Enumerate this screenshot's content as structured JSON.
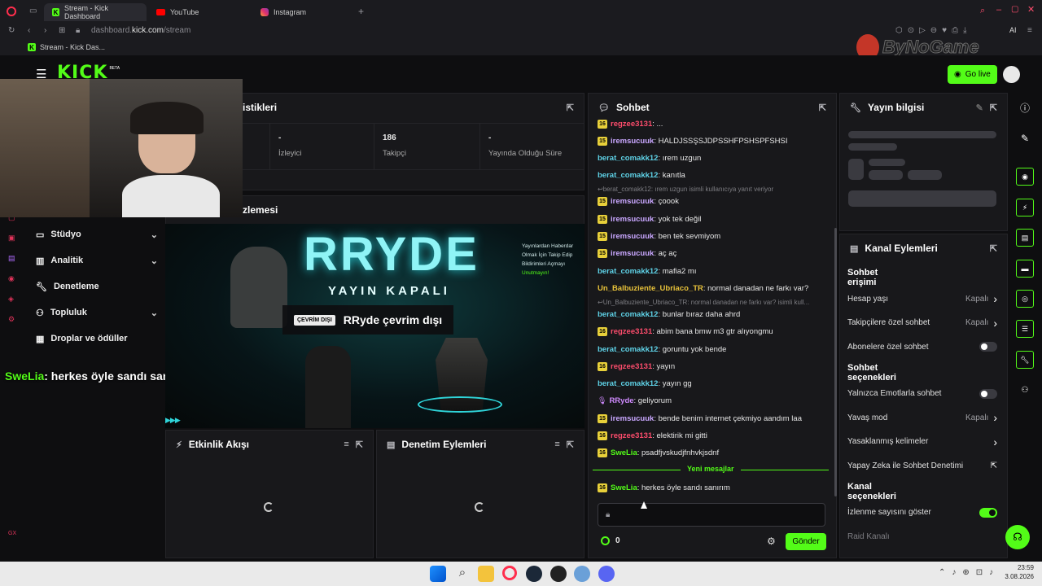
{
  "browser": {
    "tabs": [
      {
        "label": "Stream - Kick Dashboard",
        "active": true
      },
      {
        "label": "YouTube"
      },
      {
        "label": "Instagram"
      }
    ],
    "address_host": "dashboard.",
    "address_domain": "kick.com",
    "address_path": "/stream",
    "bookmark": "Stream - Kick Das..."
  },
  "watermark": "ByNoGame",
  "kick": {
    "logo": "KICK",
    "logo_beta": "BETA",
    "go_live": "Go live"
  },
  "stats": {
    "title": "istikleri",
    "cols": [
      {
        "value": "-",
        "label": "İzleyici"
      },
      {
        "value": "186",
        "label": "Takipçi"
      },
      {
        "value": "-",
        "label": "Yayında Olduğu Süre"
      }
    ]
  },
  "preview": {
    "title": "zlemesi",
    "banner_title": "RRYDE",
    "banner_sub": "YAYIN KAPALI",
    "banner_note": [
      "Yayınlardan Haberdar",
      "Olmak İçin Takip Edip",
      "Bildirimleri Açmayı"
    ],
    "banner_note_accent": "Unutmayın!",
    "offline_badge": "ÇEVRİM DIŞI",
    "offline_text": "RRyde çevrim dışı"
  },
  "sidebar": {
    "items": [
      {
        "label": "Stüdyo",
        "chevron": true
      },
      {
        "label": "Analitik",
        "chevron": true
      },
      {
        "label": "Denetleme",
        "chevron": false
      },
      {
        "label": "Topluluk",
        "chevron": true
      },
      {
        "label": "Droplar ve ödüller",
        "chevron": false
      }
    ],
    "caption_user": "SweLia",
    "caption_text": ": herkes öyle sandı sanırım",
    "footer_tag": "GX"
  },
  "activity": {
    "title": "Etkinlik Akışı"
  },
  "moderation": {
    "title": "Denetim Eylemleri"
  },
  "chat": {
    "title": "Sohbet",
    "messages": [
      {
        "badge": "16",
        "user": "regzee3131",
        "color": "#ff4d6d",
        "text": ": ..."
      },
      {
        "badge": "15",
        "user": "iremsucuuk",
        "color": "#c9a7ff",
        "text": ": HALDJSSŞSJDPSSHFPSHSPFSHSI"
      },
      {
        "badge": "",
        "user": "berat_comakk12",
        "color": "#5fd3e8",
        "text": ": ırem uzgun"
      },
      {
        "badge": "",
        "user": "berat_comakk12",
        "color": "#5fd3e8",
        "text": ": kanıtla"
      },
      {
        "reply": "berat_comakk12: ırem uzgun isimli kullanıcıya yanıt veriyor"
      },
      {
        "badge": "15",
        "user": "iremsucuuk",
        "color": "#c9a7ff",
        "text": ": çoook"
      },
      {
        "badge": "15",
        "user": "iremsucuuk",
        "color": "#c9a7ff",
        "text": ": yok tek değil"
      },
      {
        "badge": "15",
        "user": "iremsucuuk",
        "color": "#c9a7ff",
        "text": ": ben tek sevmiyom"
      },
      {
        "badge": "15",
        "user": "iremsucuuk",
        "color": "#c9a7ff",
        "text": ": aç aç"
      },
      {
        "badge": "",
        "user": "berat_comakk12",
        "color": "#5fd3e8",
        "text": ": mafia2 mı"
      },
      {
        "badge": "",
        "user": "Un_Balbuziente_Ubriaco_TR",
        "color": "#e8c23a",
        "text": ": normal danadan ne farkı var?"
      },
      {
        "reply": "Un_Balbuziente_Ubriaco_TR: normal danadan ne farkı var? isimli kull..."
      },
      {
        "badge": "",
        "user": "berat_comakk12",
        "color": "#5fd3e8",
        "text": ": bunlar bıraz daha ahrd"
      },
      {
        "badge": "16",
        "user": "regzee3131",
        "color": "#ff4d6d",
        "text": ": abim bana bmw m3 gtr alıyongmu"
      },
      {
        "badge": "",
        "user": "berat_comakk12",
        "color": "#5fd3e8",
        "text": ": goruntu yok bende"
      },
      {
        "badge": "16",
        "user": "regzee3131",
        "color": "#ff4d6d",
        "text": ": yayın"
      },
      {
        "badge": "",
        "user": "berat_comakk12",
        "color": "#5fd3e8",
        "text": ": yayın gg"
      },
      {
        "badge": "mic",
        "user": "RRyde",
        "color": "#d08bff",
        "text": ": geliyorum"
      },
      {
        "badge": "15",
        "user": "iremsucuuk",
        "color": "#c9a7ff",
        "text": ": bende benim internet çekmiyo aandım laa"
      },
      {
        "badge": "16",
        "user": "regzee3131",
        "color": "#ff4d6d",
        "text": ": elektirik mi gitti"
      },
      {
        "badge": "16",
        "user": "SweLia",
        "color": "#53fc18",
        "text": ": psadfjvskudjfnhvkjsdnf"
      }
    ],
    "new_messages": "Yeni mesajlar",
    "last_message": {
      "badge": "16",
      "user": "SweLia",
      "color": "#53fc18",
      "text": ": herkes öyle sandı sanırım"
    },
    "input_placeholder": "",
    "points": "0",
    "send": "Gönder"
  },
  "stream_info": {
    "title": "Yayın bilgisi"
  },
  "channel_actions": {
    "title": "Kanal Eylemleri",
    "sections": [
      {
        "heading": "Sohbet erişimi",
        "rows": [
          {
            "label": "Hesap yaşı",
            "value": "Kapalı",
            "kind": "arrow"
          },
          {
            "label": "Takipçilere özel sohbet",
            "value": "Kapalı",
            "kind": "arrow"
          },
          {
            "label": "Abonelere özel sohbet",
            "kind": "toggle",
            "on": false
          }
        ]
      },
      {
        "heading": "Sohbet seçenekleri",
        "rows": [
          {
            "label": "Yalnızca Emotlarla sohbet",
            "kind": "toggle",
            "on": false
          },
          {
            "label": "Yavaş mod",
            "value": "Kapalı",
            "kind": "arrow"
          },
          {
            "label": "Yasaklanmış kelimeler",
            "kind": "arrow"
          },
          {
            "label": "Yapay Zeka ile Sohbet Denetimi",
            "kind": "external"
          }
        ]
      },
      {
        "heading": "Kanal seçenekleri",
        "rows": [
          {
            "label": "İzlenme sayısını göster",
            "kind": "toggle",
            "on": true
          },
          {
            "label": "Raid Kanalı",
            "kind": "dim"
          }
        ]
      }
    ]
  },
  "taskbar": {
    "time": "23:59",
    "date": "3.08.2026"
  },
  "colors": {
    "accent": "#53fc18",
    "panel": "#18181b",
    "bg": "#0e0e10"
  }
}
